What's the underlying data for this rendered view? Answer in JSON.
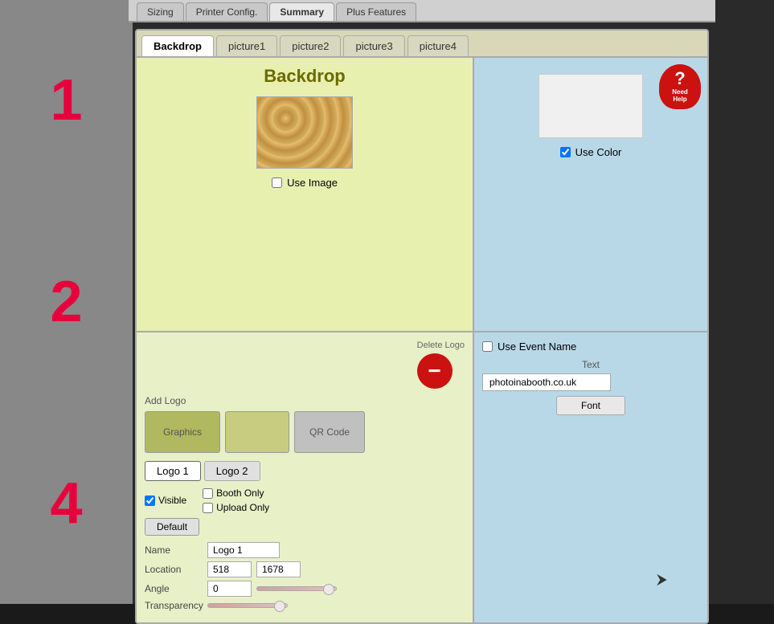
{
  "topNav": {
    "tabs": [
      {
        "label": "Sizing",
        "active": false
      },
      {
        "label": "Printer Config.",
        "active": false
      },
      {
        "label": "Summary",
        "active": false
      },
      {
        "label": "Plus Features",
        "active": false
      }
    ]
  },
  "innerTabs": {
    "tabs": [
      {
        "label": "Backdrop",
        "active": true
      },
      {
        "label": "picture1",
        "active": false
      },
      {
        "label": "picture2",
        "active": false
      },
      {
        "label": "picture3",
        "active": false
      },
      {
        "label": "picture4",
        "active": false
      }
    ]
  },
  "backdrop": {
    "title": "Backdrop",
    "useImageLabel": "Use Image",
    "useColorLabel": "Use Color"
  },
  "help": {
    "symbol": "?",
    "text": "Need\nHelp"
  },
  "addLogo": {
    "label": "Add Logo",
    "graphicsBtn": "Graphics",
    "btn2Label": "",
    "qrCodeBtn": "QR Code",
    "deleteLogoLabel": "Delete Logo"
  },
  "logoTabs": {
    "logo1": "Logo 1",
    "logo2": "Logo 2"
  },
  "logoSettings": {
    "visibleLabel": "Visible",
    "boothOnlyLabel": "Booth Only",
    "uploadOnlyLabel": "Upload Only",
    "defaultBtn": "Default",
    "nameLabel": "Name",
    "nameValue": "Logo 1",
    "locationLabel": "Location",
    "locationX": "518",
    "locationY": "1678",
    "angleLabel": "Angle",
    "angleValue": "0",
    "transparencyLabel": "Transparency"
  },
  "eventSection": {
    "useEventNameLabel": "Use Event Name",
    "textLabel": "Text",
    "textValue": "photoinabooth.co.uk",
    "fontBtn": "Font"
  },
  "sideNumbers": [
    "1",
    "2",
    "4"
  ],
  "colors": {
    "accent": "#e8003d",
    "backdrop_bg": "#e8f0b0",
    "right_bg": "#b8d8e8",
    "logo_bg": "#e8f0c8",
    "btn_yellow": "#c8cc80"
  }
}
